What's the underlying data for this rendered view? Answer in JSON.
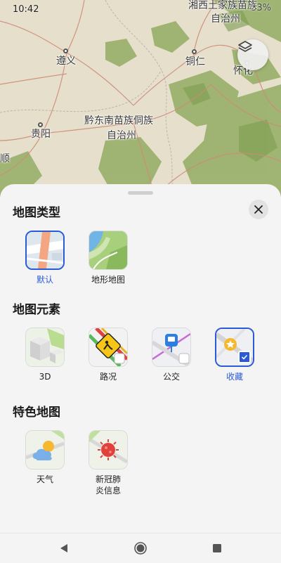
{
  "status_bar": {
    "time": "10:42",
    "battery": "33%"
  },
  "map": {
    "labels": {
      "top_region_line1": "湘西土家族苗族",
      "top_region_line2": "自治州",
      "zunyi": "遵义",
      "tongren": "铜仁",
      "huaihua": "怀化",
      "qiandongnan_line1": "黔东南苗族侗族",
      "qiandongnan_line2": "自治州",
      "guiyang": "贵阳",
      "anshun_partial": "顺"
    },
    "layers_button_icon": "layers-icon"
  },
  "sheet": {
    "close_icon": "close-icon",
    "sections": {
      "map_type": {
        "title": "地图类型",
        "items": [
          {
            "label": "默认",
            "icon": "default-map-thumb",
            "selected": true
          },
          {
            "label": "地形地图",
            "icon": "terrain-map-thumb",
            "selected": false
          }
        ]
      },
      "map_elements": {
        "title": "地图元素",
        "items": [
          {
            "label": "3D",
            "icon": "3d-buildings-thumb",
            "checked": false
          },
          {
            "label": "路况",
            "icon": "traffic-thumb",
            "checked": false
          },
          {
            "label": "公交",
            "icon": "transit-thumb",
            "checked": false
          },
          {
            "label": "收藏",
            "icon": "favorites-thumb",
            "checked": true
          }
        ]
      },
      "feature_maps": {
        "title": "特色地图",
        "items": [
          {
            "label": "天气",
            "icon": "weather-thumb"
          },
          {
            "label_line1": "新冠肺",
            "label_line2": "炎信息",
            "icon": "covid-thumb"
          }
        ]
      }
    }
  },
  "nav_bar": {
    "back_icon": "back-icon",
    "home_icon": "home-icon",
    "recents_icon": "recents-icon"
  },
  "colors": {
    "accent": "#2a5bd7",
    "sheet_bg": "#f4f4f4",
    "map_land": "#e8e2d2",
    "map_forest": "#8ba95a",
    "map_road": "#c97a6a"
  }
}
